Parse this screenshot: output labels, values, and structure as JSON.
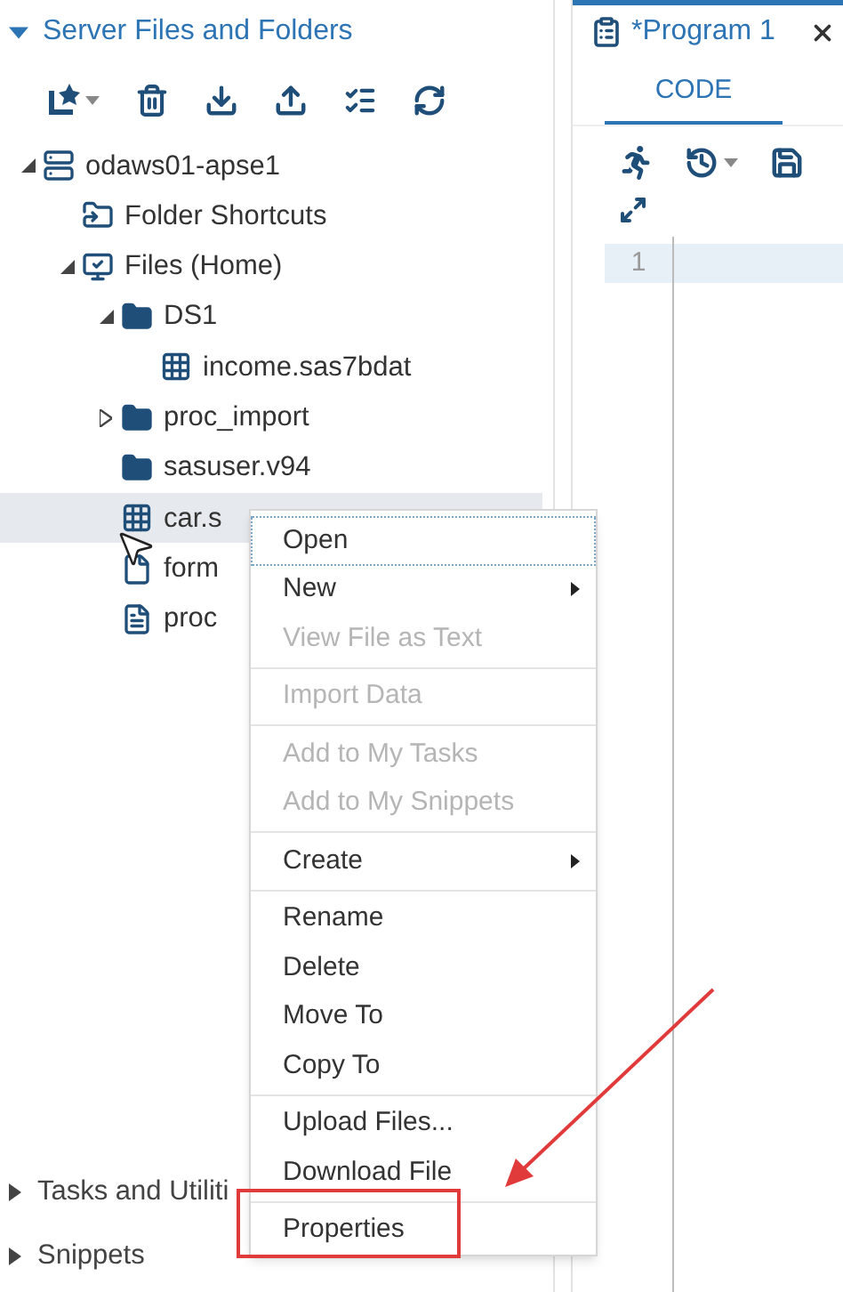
{
  "sidebar": {
    "title": "Server Files and Folders",
    "expanded": true,
    "tree": [
      {
        "label": "odaws01-apse1",
        "kind": "server",
        "expanded": true,
        "selected": false,
        "children": [
          {
            "label": "Folder Shortcuts",
            "kind": "shortcut",
            "selected": false
          },
          {
            "label": "Files (Home)",
            "kind": "home",
            "expanded": true,
            "selected": false,
            "children": [
              {
                "label": "DS1",
                "kind": "folder",
                "expanded": true,
                "selected": false,
                "children": [
                  {
                    "label": "income.sas7bdat",
                    "kind": "dataset",
                    "selected": false
                  }
                ]
              },
              {
                "label": "proc_import",
                "kind": "folder",
                "expanded": false,
                "selected": false
              },
              {
                "label": "sasuser.v94",
                "kind": "folder",
                "selected": false
              },
              {
                "label": "car.s",
                "kind": "dataset",
                "selected": true
              },
              {
                "label": "form",
                "kind": "file",
                "selected": false
              },
              {
                "label": "proc",
                "kind": "document",
                "selected": false
              }
            ]
          }
        ]
      }
    ],
    "sections": [
      {
        "label": "Tasks and Utiliti",
        "expanded": false
      },
      {
        "label": "Snippets",
        "expanded": false
      }
    ]
  },
  "context_menu": {
    "items": [
      {
        "kind": "item",
        "label": "Open",
        "disabled": false,
        "submenu": false,
        "selected": true
      },
      {
        "kind": "item",
        "label": "New",
        "disabled": false,
        "submenu": true,
        "selected": false
      },
      {
        "kind": "item",
        "label": "View File as Text",
        "disabled": true,
        "submenu": false,
        "selected": false
      },
      {
        "kind": "separator"
      },
      {
        "kind": "item",
        "label": "Import Data",
        "disabled": true,
        "submenu": false,
        "selected": false
      },
      {
        "kind": "separator"
      },
      {
        "kind": "item",
        "label": "Add to My Tasks",
        "disabled": true,
        "submenu": false,
        "selected": false
      },
      {
        "kind": "item",
        "label": "Add to My Snippets",
        "disabled": true,
        "submenu": false,
        "selected": false
      },
      {
        "kind": "separator"
      },
      {
        "kind": "item",
        "label": "Create",
        "disabled": false,
        "submenu": true,
        "selected": false
      },
      {
        "kind": "separator"
      },
      {
        "kind": "item",
        "label": "Rename",
        "disabled": false,
        "submenu": false,
        "selected": false
      },
      {
        "kind": "item",
        "label": "Delete",
        "disabled": false,
        "submenu": false,
        "selected": false
      },
      {
        "kind": "item",
        "label": "Move To",
        "disabled": false,
        "submenu": false,
        "selected": false
      },
      {
        "kind": "item",
        "label": "Copy To",
        "disabled": false,
        "submenu": false,
        "selected": false
      },
      {
        "kind": "separator"
      },
      {
        "kind": "item",
        "label": "Upload Files...",
        "disabled": false,
        "submenu": false,
        "selected": false
      },
      {
        "kind": "item",
        "label": "Download File",
        "disabled": false,
        "submenu": false,
        "selected": false
      },
      {
        "kind": "separator"
      },
      {
        "kind": "item",
        "label": "Properties",
        "disabled": false,
        "submenu": false,
        "selected": false
      }
    ]
  },
  "editor": {
    "tab_title": "*Program 1",
    "tabs": [
      {
        "label": "CODE",
        "selected": true
      }
    ],
    "lines": [
      {
        "number": "1",
        "current": true
      }
    ]
  }
}
